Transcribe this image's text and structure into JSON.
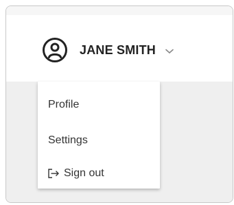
{
  "user": {
    "name": "JANE SMITH",
    "avatar_icon": "user-circle-icon",
    "dropdown_icon": "chevron-down-icon"
  },
  "menu": {
    "items": [
      {
        "label": "Profile"
      },
      {
        "label": "Settings"
      },
      {
        "label": "Sign out",
        "icon": "sign-out-icon"
      }
    ]
  },
  "colors": {
    "background_top": "#f6f6f6",
    "header": "#ffffff",
    "content": "#efefef",
    "text": "#222222"
  }
}
